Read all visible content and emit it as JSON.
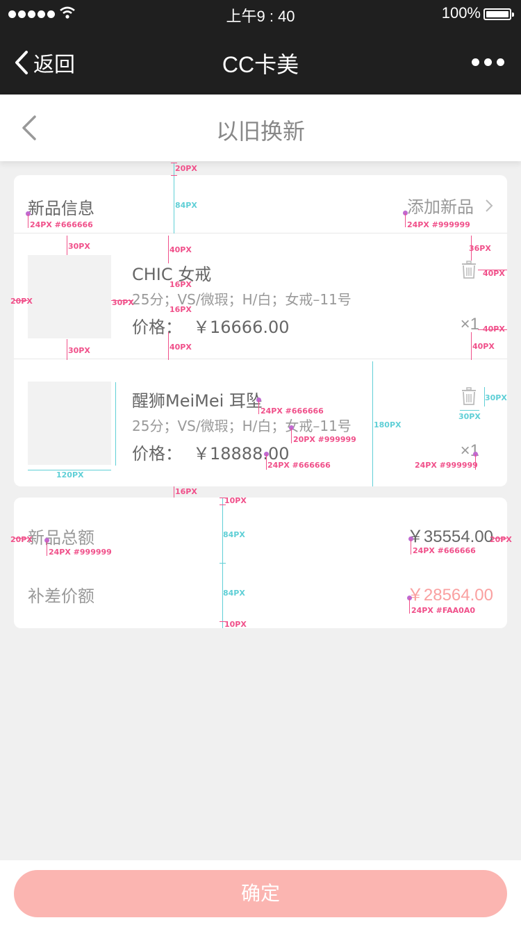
{
  "status_bar": {
    "time": "上午9 : 40",
    "battery": "100%"
  },
  "wechat_nav": {
    "back_label": "返回",
    "title": "CC卡美"
  },
  "page": {
    "title": "以旧换新"
  },
  "new_items_section": {
    "title": "新品信息",
    "add_label": "添加新品",
    "items": [
      {
        "name": "CHIC 女戒",
        "spec": "25分；VS/微瑕；H/白；女戒–11号",
        "price_label": "价格：",
        "price": "￥16666.00",
        "quantity": "×1"
      },
      {
        "name": "醒狮MeiMei 耳坠",
        "spec": "25分；VS/微瑕；H/白；女戒–11号",
        "price_label": "价格：",
        "price": "￥18888.00",
        "quantity": "×1"
      }
    ]
  },
  "summary": {
    "total_label": "新品总额",
    "total_value": "￥35554.00",
    "diff_label": "补差价额",
    "diff_value": "￥28564.00"
  },
  "confirm_button": {
    "label": "确定"
  },
  "annotations": {
    "a20px_top": "20PX",
    "a84px_head": "84PX",
    "a24_666": "24PX #666666",
    "a24_999": "24PX #999999",
    "a30px_a": "30PX",
    "a40px_a": "40PX",
    "a36px": "36PX",
    "a40px_b": "40PX",
    "a20px_left": "20PX",
    "a30px_b": "30PX",
    "a16px_a": "16PX",
    "a16px_b": "16PX",
    "a40px_c": "40PX",
    "a40px_d": "40PX",
    "a40px_e": "40PX",
    "a30px_c": "30PX",
    "a24_666_b": "24PX #666666",
    "a20_999": "20PX #999999",
    "a180px": "180PX",
    "a30px_d": "30PX",
    "a30px_e": "30PX",
    "a120px": "120PX",
    "a24_666_c": "24PX #666666",
    "a24_999_b": "24PX #999999",
    "a16px_c": "16PX",
    "a10px_a": "10PX",
    "a84px_a": "84PX",
    "a84px_b": "84PX",
    "a10px_b": "10PX",
    "a20px_l2": "20PX",
    "a24_999_c": "24PX #999999",
    "a24_666_d": "24PX #666666",
    "a20px_r2": "20PX",
    "a24_faa": "24PX #FAA0A0"
  },
  "colors": {
    "nav_bg": "#1f1f1f",
    "accent": "#FAA0A0",
    "confirm_bg": "#fbb5b1",
    "text_primary": "#666666",
    "text_secondary": "#999999"
  }
}
